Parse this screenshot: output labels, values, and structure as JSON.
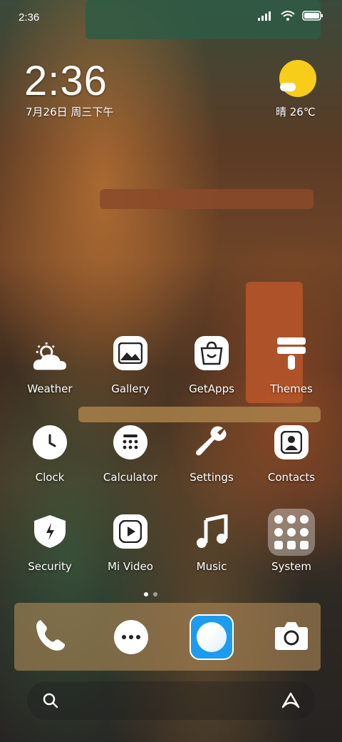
{
  "status_bar": {
    "time": "2:36",
    "icons": [
      "signal-icon",
      "wifi-icon",
      "battery-icon"
    ]
  },
  "clock_widget": {
    "time": "2:36",
    "date": "7月26日 周三下午"
  },
  "weather_widget": {
    "condition_icon": "sun-cloud-icon",
    "text": "晴 26℃"
  },
  "apps": [
    {
      "label": "Weather",
      "icon": "weather-icon"
    },
    {
      "label": "Gallery",
      "icon": "gallery-icon"
    },
    {
      "label": "GetApps",
      "icon": "getapps-icon"
    },
    {
      "label": "Themes",
      "icon": "themes-icon"
    },
    {
      "label": "Clock",
      "icon": "clock-icon"
    },
    {
      "label": "Calculator",
      "icon": "calculator-icon"
    },
    {
      "label": "Settings",
      "icon": "settings-icon"
    },
    {
      "label": "Contacts",
      "icon": "contacts-icon"
    },
    {
      "label": "Security",
      "icon": "security-icon"
    },
    {
      "label": "Mi Video",
      "icon": "video-icon"
    },
    {
      "label": "Music",
      "icon": "music-icon"
    },
    {
      "label": "System",
      "icon": "system-folder-icon"
    }
  ],
  "page_indicator": {
    "pages": 2,
    "current": 1
  },
  "dock": [
    "phone-icon",
    "messages-icon",
    "browser-icon",
    "camera-icon"
  ],
  "search_bar": {
    "left_icon": "search-icon",
    "right_icon": "assistant-icon"
  },
  "colors": {
    "weather_sun": "#f8cd1a",
    "browser_accent": "#1d9bf0"
  }
}
